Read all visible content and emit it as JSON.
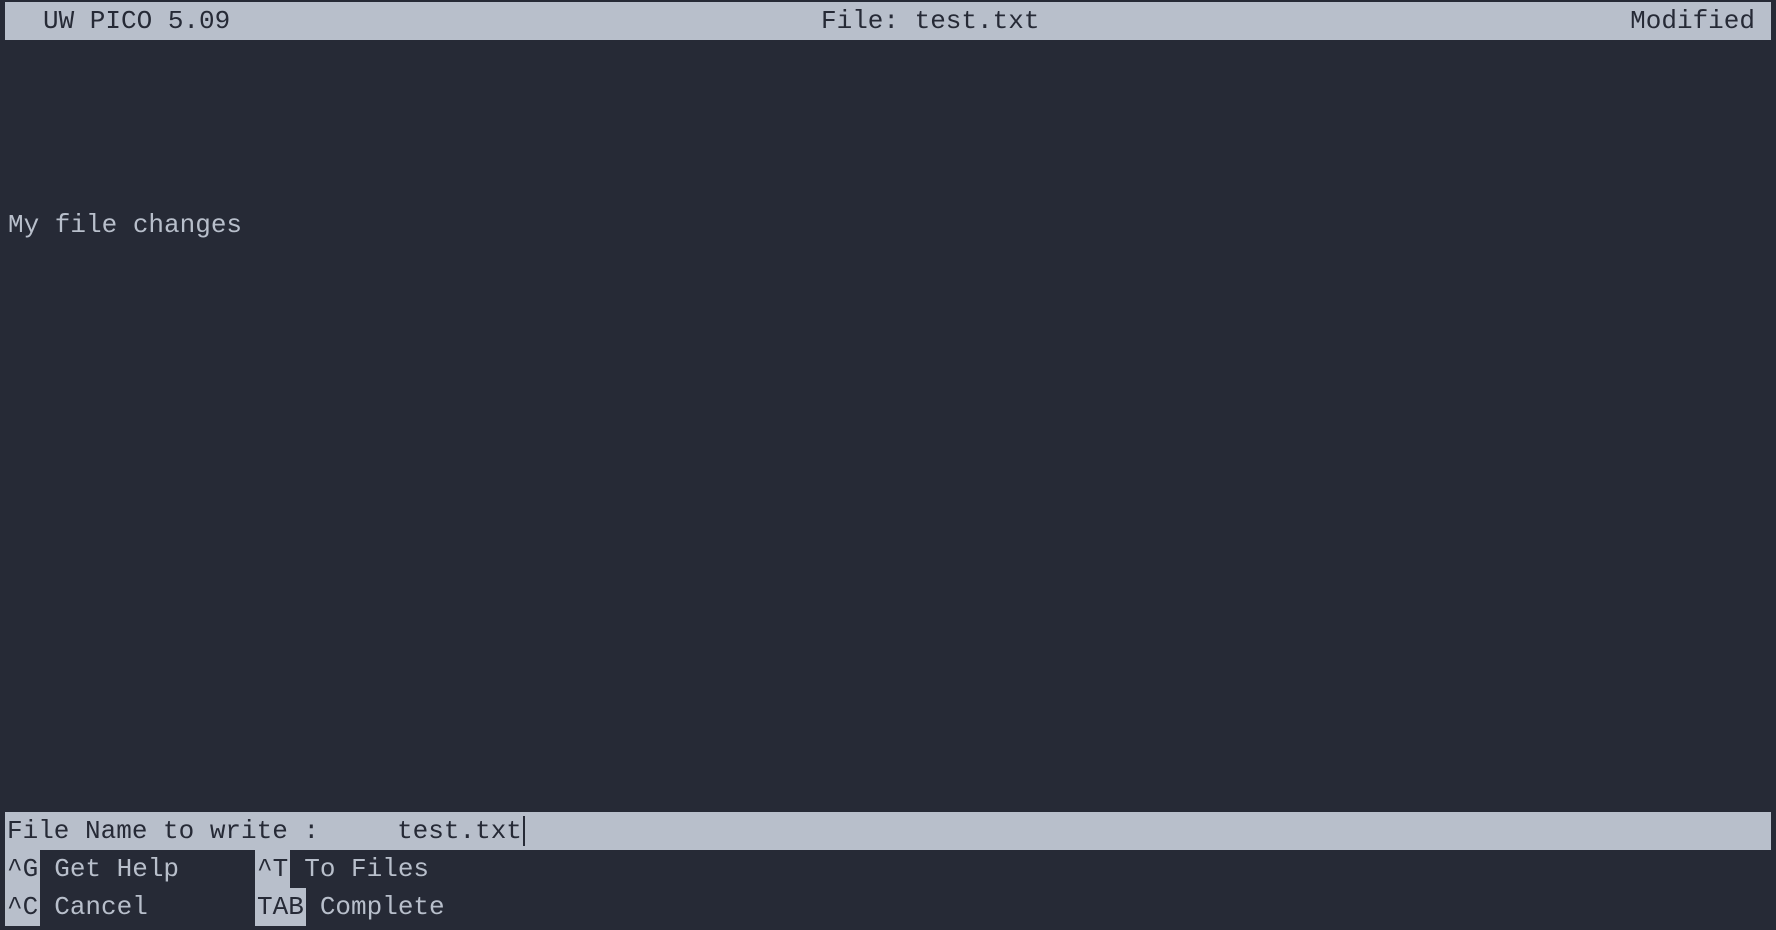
{
  "titleBar": {
    "appName": "UW PICO 5.09",
    "fileLabel": "File: test.txt",
    "status": "Modified"
  },
  "editor": {
    "line1": "My file changes"
  },
  "prompt": {
    "label": "File Name to write : ",
    "value": "test.txt"
  },
  "help": {
    "row1": {
      "item1": {
        "key": "^G",
        "label": "Get Help"
      },
      "item2": {
        "key": "^T",
        "label": "To Files"
      }
    },
    "row2": {
      "item1": {
        "key": "^C",
        "label": "Cancel"
      },
      "item2": {
        "key": "TAB",
        "label": "Complete"
      }
    }
  }
}
